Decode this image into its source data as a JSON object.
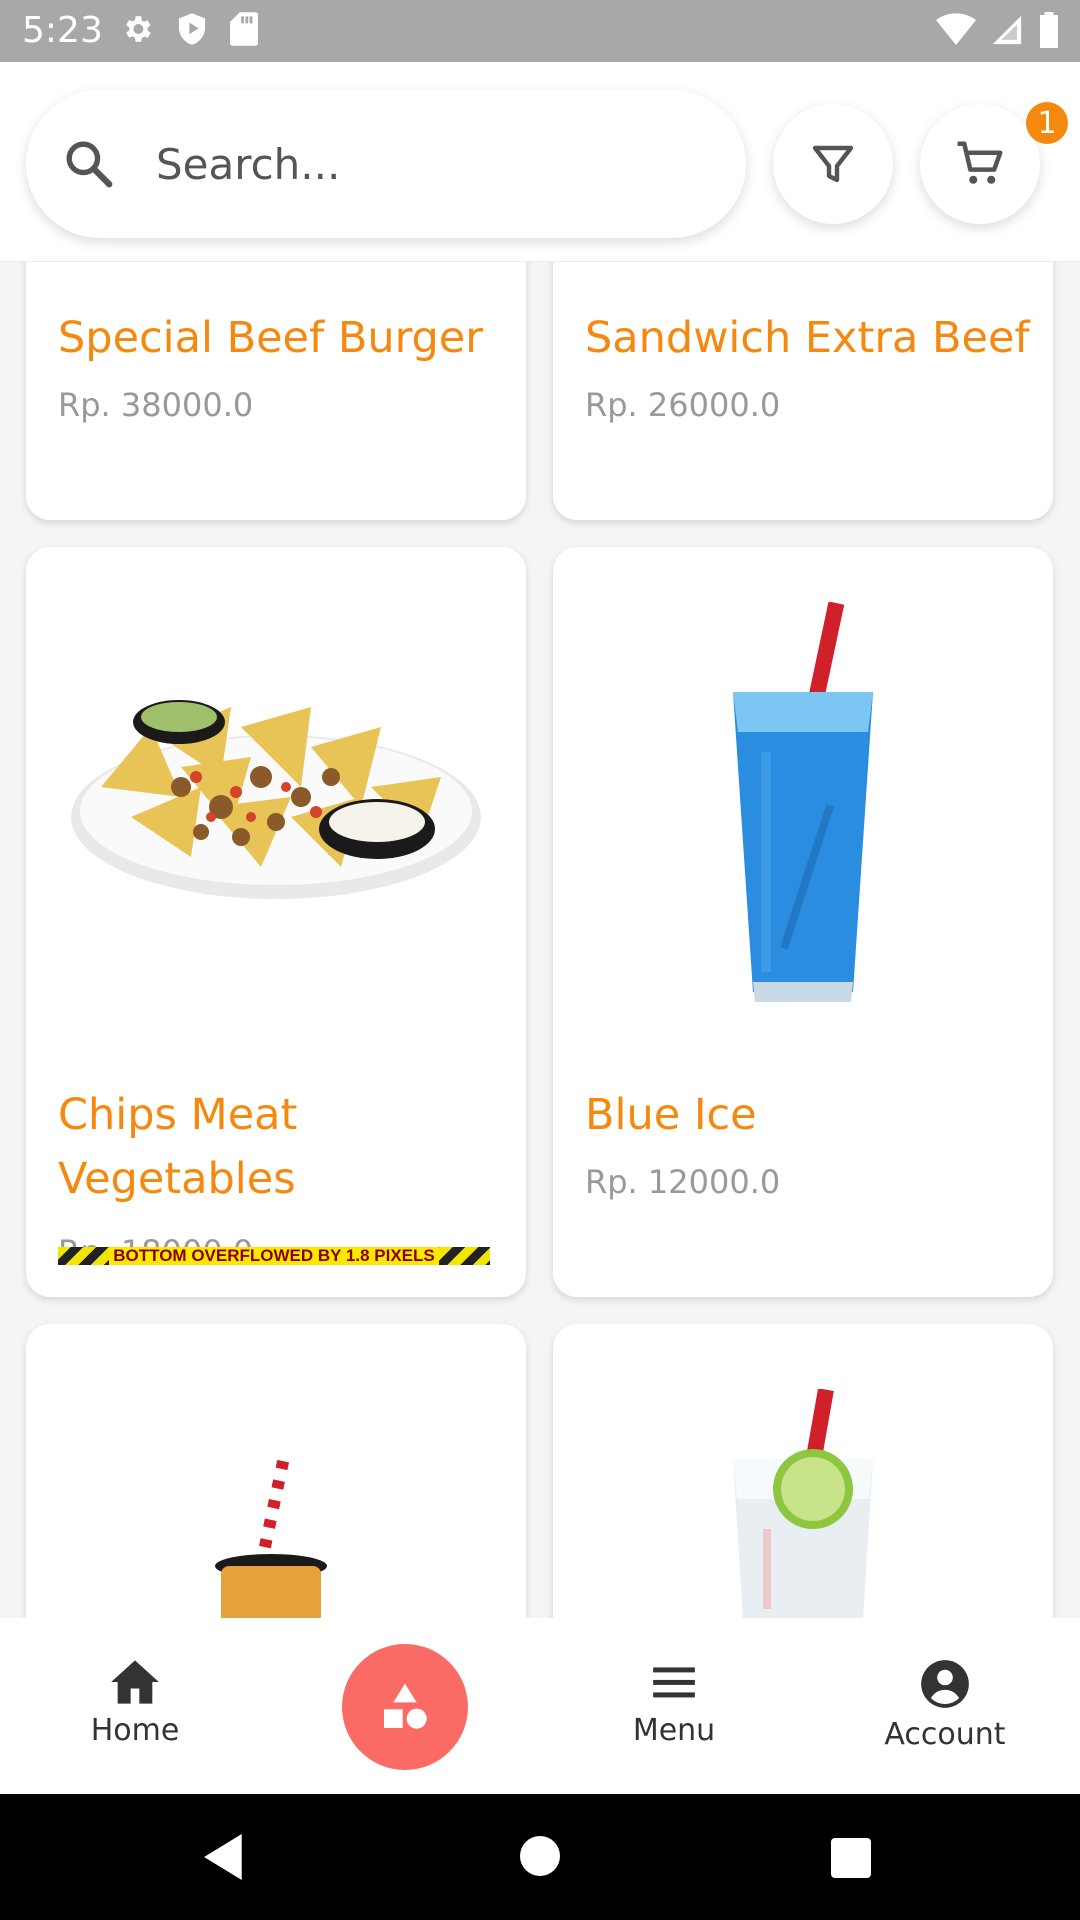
{
  "status_bar": {
    "time": "5:23"
  },
  "search": {
    "placeholder": "Search..."
  },
  "cart": {
    "badge_count": "1"
  },
  "products": [
    {
      "name": "Special Beef Burger",
      "price": "Rp. 38000.0"
    },
    {
      "name": "Sandwich Extra Beef",
      "price": "Rp. 26000.0"
    },
    {
      "name": "Chips Meat Vegetables",
      "price": "Rp. 18000.0"
    },
    {
      "name": "Blue Ice",
      "price": "Rp. 12000.0"
    },
    {
      "name": "",
      "price": ""
    },
    {
      "name": "",
      "price": ""
    }
  ],
  "debug": {
    "overflow_message": "BOTTOM OVERFLOWED BY 1.8 PIXELS"
  },
  "bottom_nav": {
    "home_label": "Home",
    "menu_label": "Menu",
    "account_label": "Account"
  },
  "colors": {
    "accent_orange": "#f5890f",
    "fab_red": "#f96b64",
    "price_grey": "#999999"
  }
}
